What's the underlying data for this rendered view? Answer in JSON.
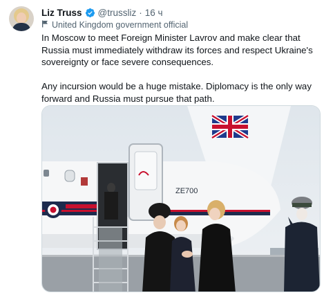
{
  "tweet": {
    "author_name": "Liz Truss",
    "handle": "@trussliz",
    "separator": "·",
    "time": "16 ч",
    "affiliation": "United Kingdom government official",
    "paragraphs": [
      "In Moscow to meet Foreign Minister Lavrov and make clear that Russia must immediately withdraw its forces and respect Ukraine's sovereignty or face severe consequences.",
      "Any incursion would be a huge mistake. Diplomacy is the only way forward and Russia must pursue that path."
    ],
    "image": {
      "aircraft_registration": "ZE700"
    }
  },
  "colors": {
    "verified_badge": "#1d9bf0",
    "secondary_text": "#536471"
  },
  "icons": {
    "verified": "verified-badge-icon",
    "affiliation": "flag-icon"
  }
}
